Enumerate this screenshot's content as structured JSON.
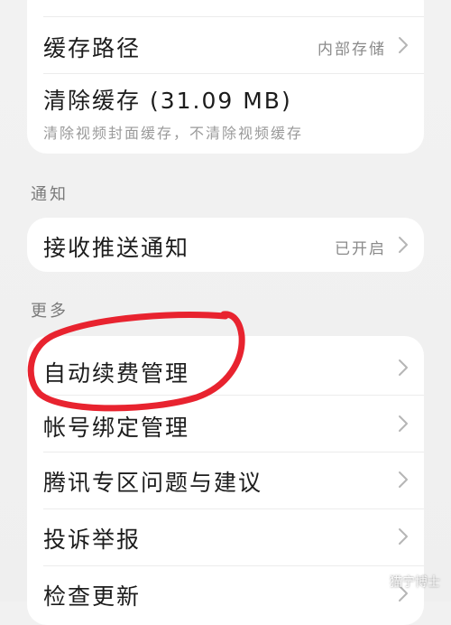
{
  "colors": {
    "background": "#f1f1f1",
    "card": "#ffffff",
    "annotation_red": "#e8232f"
  },
  "storage_card": {
    "cache_path_label": "缓存路径",
    "cache_path_value": "内部存储",
    "clear_cache_label": "清除缓存 (31.09 MB)",
    "clear_cache_subtext": "清除视频封面缓存，不清除视频缓存"
  },
  "notification_section": {
    "title": "通知",
    "push_label": "接收推送通知",
    "push_value": "已开启"
  },
  "more_section": {
    "title": "更多",
    "items": [
      {
        "label": "自动续费管理"
      },
      {
        "label": "帐号绑定管理"
      },
      {
        "label": "腾讯专区问题与建议"
      },
      {
        "label": "投诉举报"
      },
      {
        "label": "检查更新"
      }
    ]
  },
  "watermark": {
    "text": "猫宁博士"
  }
}
